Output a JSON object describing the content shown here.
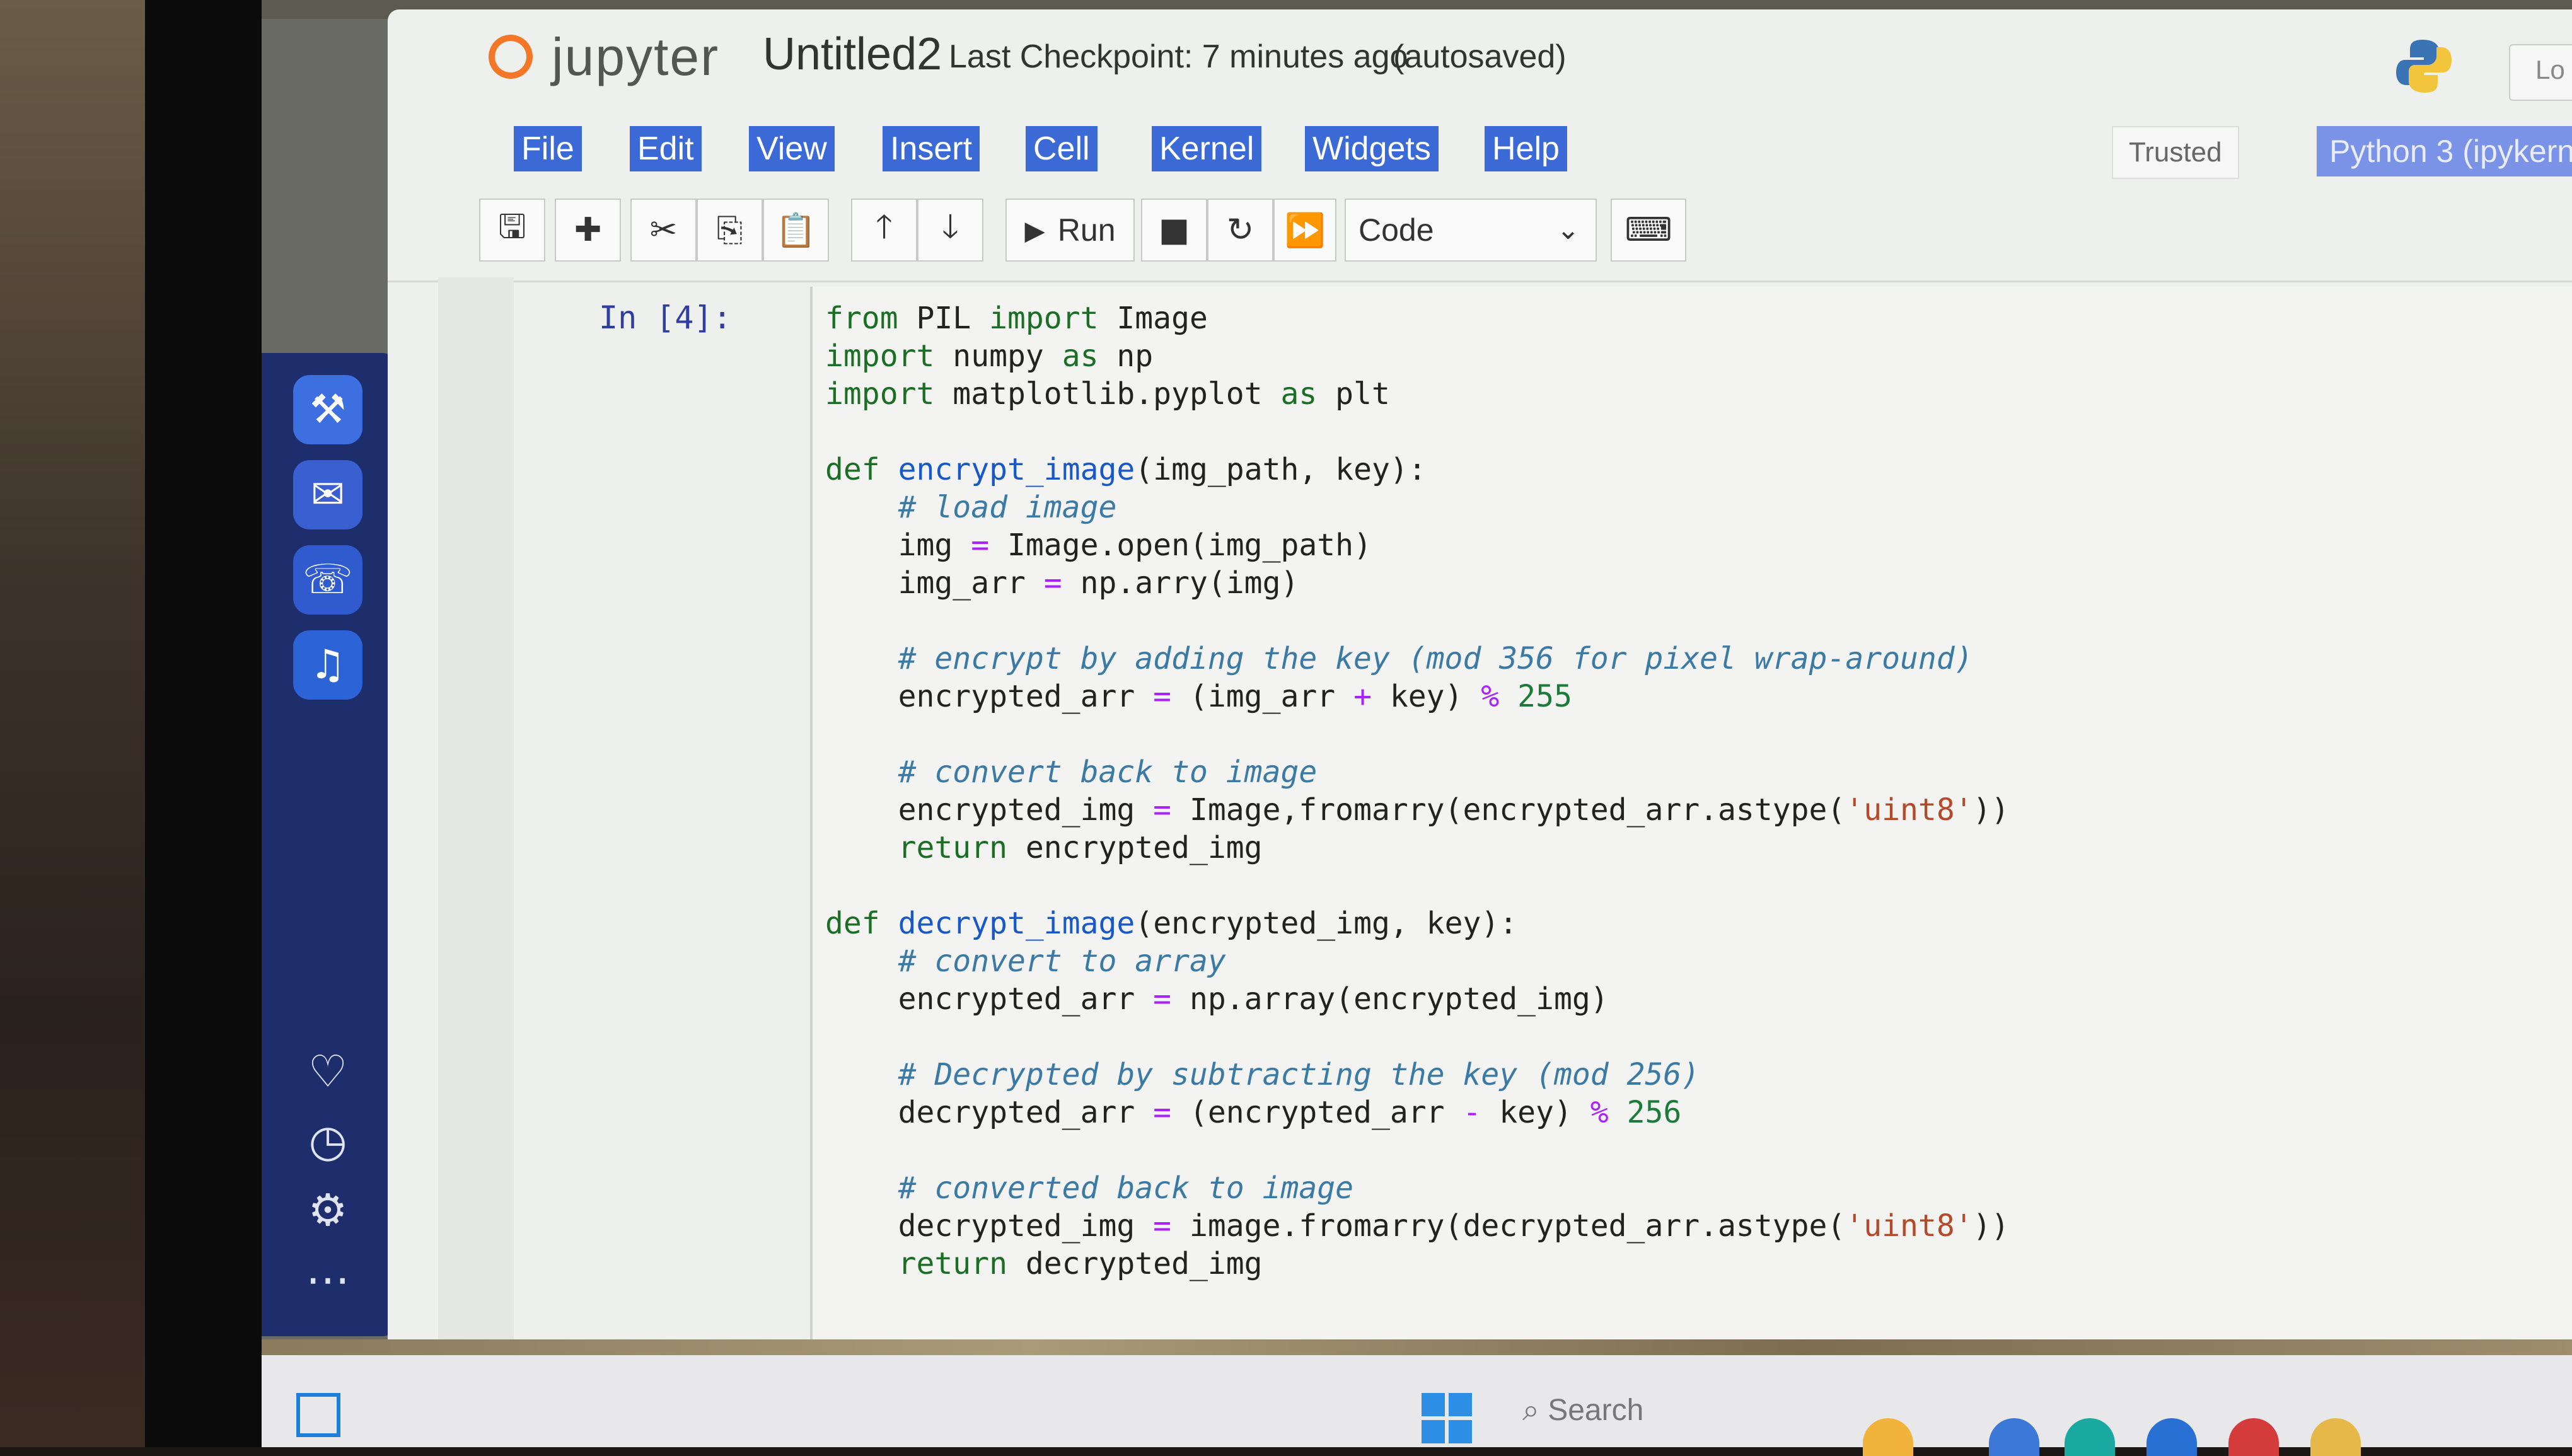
{
  "header": {
    "logo_text": "jupyter",
    "notebook_name": "Untitled2",
    "checkpoint": "Last Checkpoint: 7 minutes ago",
    "autosaved": "(autosaved)",
    "logout": "Lo"
  },
  "menu": {
    "items": [
      "File",
      "Edit",
      "View",
      "Insert",
      "Cell",
      "Kernel",
      "Widgets",
      "Help"
    ],
    "trusted": "Trusted",
    "kernel": "Python 3 (ipykerne"
  },
  "toolbar": {
    "run_label": "Run",
    "cell_type": "Code",
    "icons": [
      "save-icon",
      "plus-icon",
      "scissors-icon",
      "copy-icon",
      "paste-icon",
      "arrow-up-icon",
      "arrow-down-icon",
      "play-icon",
      "stop-icon",
      "restart-icon",
      "fast-forward-icon",
      "keyboard-icon"
    ]
  },
  "cell": {
    "prompt": "In [4]:"
  },
  "taskbar": {
    "search_placeholder": "Search"
  },
  "colors": {
    "menu_highlight": "#3b6ad6",
    "jupyter_orange": "#f37726",
    "rail_bg": "#1e2d6b"
  }
}
